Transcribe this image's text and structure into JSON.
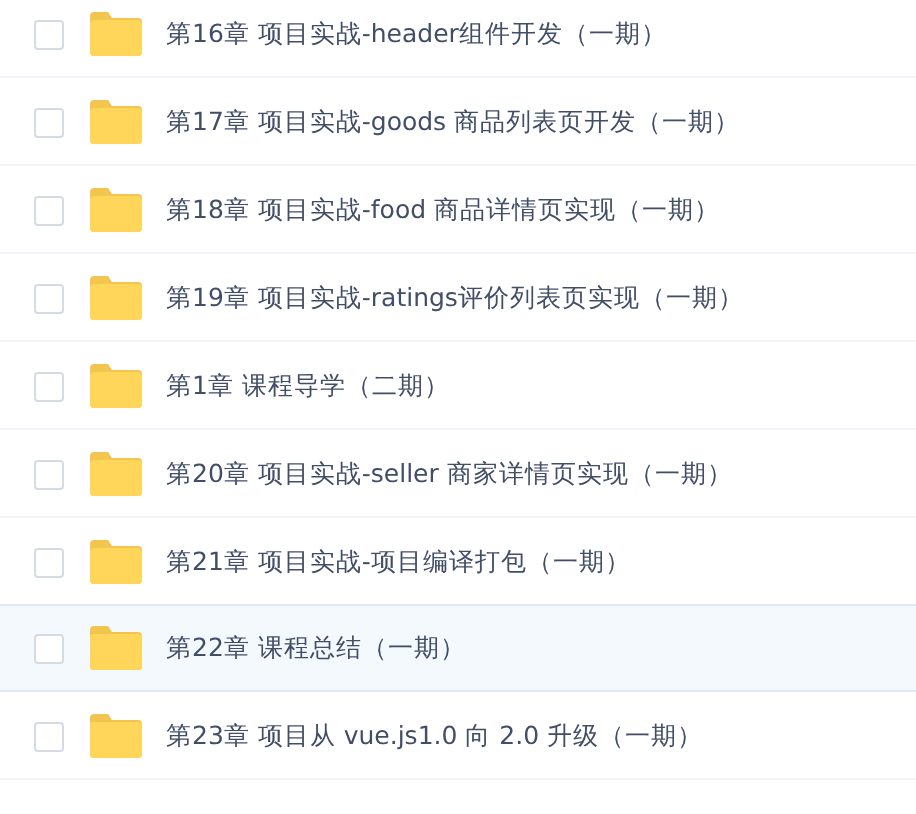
{
  "folders": [
    {
      "name": "第16章 项目实战-header组件开发（一期）",
      "checked": false,
      "selected": false
    },
    {
      "name": "第17章 项目实战-goods 商品列表页开发（一期）",
      "checked": false,
      "selected": false
    },
    {
      "name": "第18章 项目实战-food 商品详情页实现（一期）",
      "checked": false,
      "selected": false
    },
    {
      "name": "第19章 项目实战-ratings评价列表页实现（一期）",
      "checked": false,
      "selected": false
    },
    {
      "name": "第1章 课程导学（二期）",
      "checked": false,
      "selected": false
    },
    {
      "name": "第20章 项目实战-seller 商家详情页实现（一期）",
      "checked": false,
      "selected": false
    },
    {
      "name": "第21章 项目实战-项目编译打包（一期）",
      "checked": false,
      "selected": false
    },
    {
      "name": "第22章 课程总结（一期）",
      "checked": false,
      "selected": true
    },
    {
      "name": "第23章 项目从 vue.js1.0 向 2.0 升级（一期）",
      "checked": false,
      "selected": false
    }
  ]
}
